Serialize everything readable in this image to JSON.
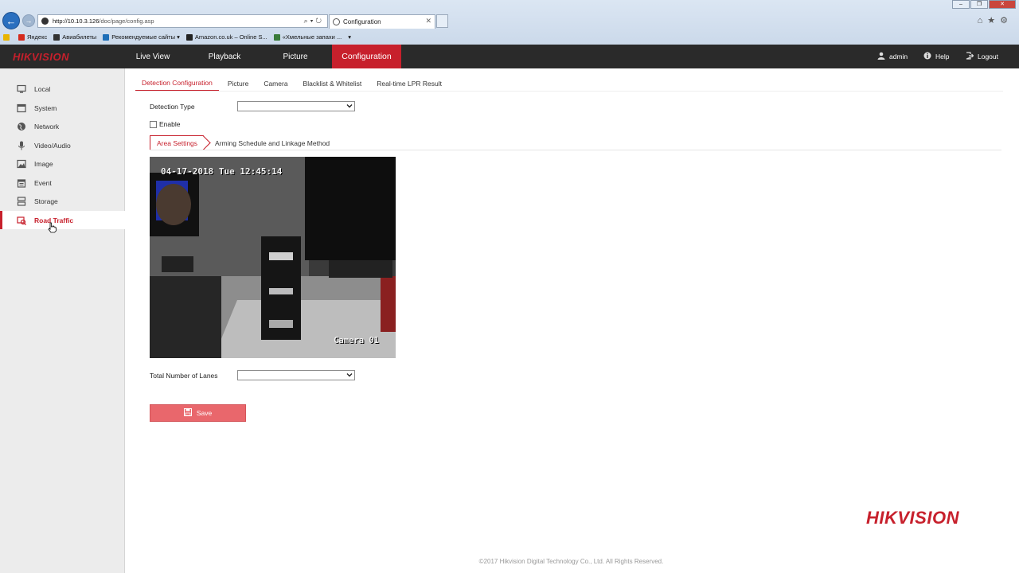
{
  "browser": {
    "url_host": "http://10.10.3.126",
    "url_path": "/doc/page/config.asp",
    "tab_title": "Configuration",
    "favorites": [
      {
        "label": "Яндекс",
        "color": "#d52b1e"
      },
      {
        "label": "Авиабилеты",
        "color": "#333333"
      },
      {
        "label": "Рекомендуемые сайты ▾",
        "color": "#1e6fb8"
      },
      {
        "label": "Amazon.co.uk – Online S...",
        "color": "#222222"
      },
      {
        "label": "«Хмельные запахи ...",
        "color": "#3a7b3a"
      }
    ]
  },
  "header": {
    "logo": "HIKVISION",
    "nav": {
      "live_view": "Live View",
      "playback": "Playback",
      "picture": "Picture",
      "configuration": "Configuration"
    },
    "user": "admin",
    "help": "Help",
    "logout": "Logout"
  },
  "sidebar": {
    "items": [
      {
        "label": "Local",
        "icon": "monitor-icon"
      },
      {
        "label": "System",
        "icon": "system-icon"
      },
      {
        "label": "Network",
        "icon": "globe-icon"
      },
      {
        "label": "Video/Audio",
        "icon": "microphone-icon"
      },
      {
        "label": "Image",
        "icon": "image-icon"
      },
      {
        "label": "Event",
        "icon": "calendar-icon"
      },
      {
        "label": "Storage",
        "icon": "storage-icon"
      },
      {
        "label": "Road Traffic",
        "icon": "road-traffic-icon",
        "active": true
      }
    ]
  },
  "subtabs": [
    "Detection Configuration",
    "Picture",
    "Camera",
    "Blacklist & Whitelist",
    "Real-time LPR Result"
  ],
  "form": {
    "detection_type_label": "Detection Type",
    "detection_type_value": "",
    "enable_label": "Enable",
    "enable_checked": false,
    "area_tabs": [
      "Area Settings",
      "Arming Schedule and Linkage Method"
    ],
    "camera": {
      "timestamp": "04-17-2018 Tue 12:45:14",
      "name": "Camera 01"
    },
    "lanes_label": "Total Number of Lanes",
    "lanes_value": "",
    "save_label": "Save"
  },
  "brand": "HIKVISION",
  "footer": "©2017 Hikvision Digital Technology Co., Ltd. All Rights Reserved.",
  "colors": {
    "accent": "#c7202c",
    "save_button": "#e9676c",
    "header_bg": "#2a2a2a"
  }
}
